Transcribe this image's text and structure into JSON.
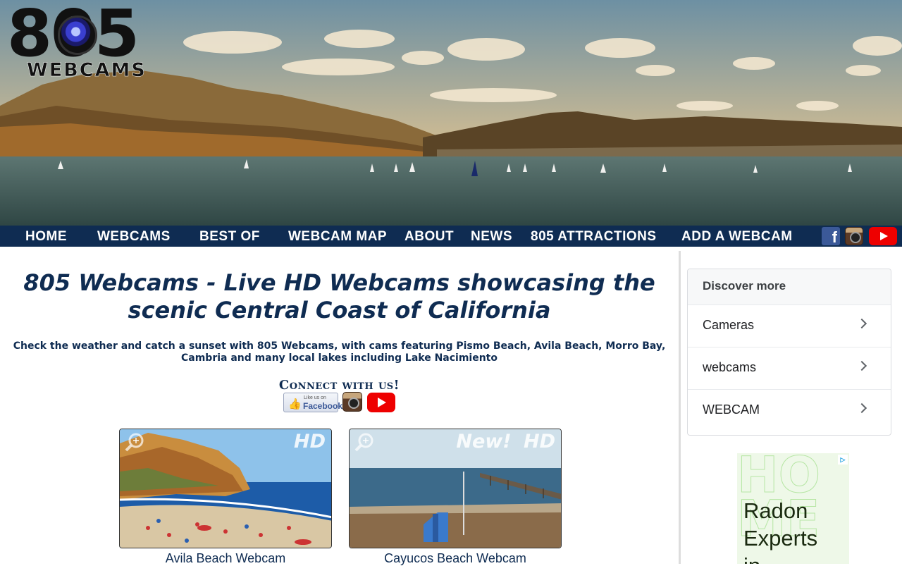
{
  "logo": {
    "number": "805",
    "word": "WEBCAMS"
  },
  "nav": {
    "items": [
      "HOME",
      "WEBCAMS",
      "BEST OF",
      "WEBCAM MAP",
      "ABOUT",
      "NEWS",
      "805 ATTRACTIONS",
      "ADD A WEBCAM"
    ],
    "social_icons": [
      "facebook-icon",
      "instagram-icon",
      "youtube-icon"
    ],
    "bar_color": "#0f2c52"
  },
  "main": {
    "title_line1": "805 Webcams - Live HD Webcams showcasing the",
    "title_line2": "scenic Central Coast of California",
    "intro_line1": "Check the weather and catch a sunset with 805 Webcams, with cams featuring Pismo Beach, Avila Beach, Morro Bay,",
    "intro_line2": "Cambria and many local lakes including Lake Nacimiento",
    "connect_label": "Connect with us!",
    "connect_fb_small": "Like us on",
    "connect_fb_big": "Facebook"
  },
  "cards": [
    {
      "caption": "Avila Beach Webcam",
      "badge": "HD"
    },
    {
      "caption": "Cayucos Beach Webcam",
      "badge": "New!  HD"
    }
  ],
  "sidebar": {
    "heading": "Discover more",
    "items": [
      "Cameras",
      "webcams",
      "WEBCAM"
    ]
  },
  "ad": {
    "line1": "Radon",
    "line2": "Experts",
    "line3": "in"
  }
}
